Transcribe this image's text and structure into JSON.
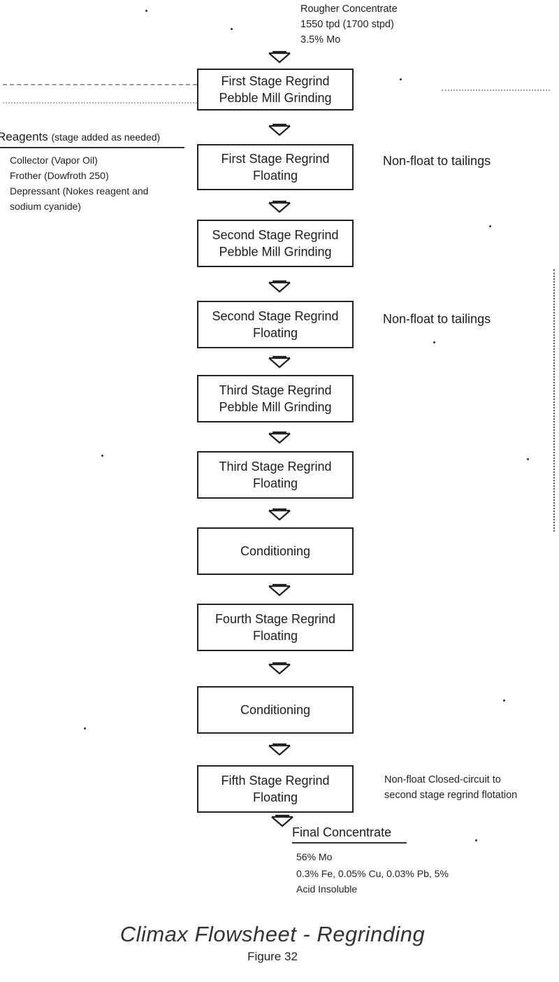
{
  "feed": {
    "title": "Rougher Concentrate",
    "rate": "1550 tpd (1700 stpd)",
    "grade": "3.5% Mo"
  },
  "reagents": {
    "heading": "Reagents",
    "heading_note": "(stage added as needed)",
    "items": [
      "Collector (Vapor Oil)",
      "Frother (Dowfroth 250)",
      "Depressant (Nokes reagent and",
      "sodium cyanide)"
    ]
  },
  "stages": [
    {
      "line1": "First Stage Regrind",
      "line2": "Pebble Mill Grinding",
      "side_note": ""
    },
    {
      "line1": "First Stage Regrind",
      "line2": "Floating",
      "side_note": "Non-float to tailings"
    },
    {
      "line1": "Second Stage Regrind",
      "line2": "Pebble Mill Grinding",
      "side_note": ""
    },
    {
      "line1": "Second Stage Regrind",
      "line2": "Floating",
      "side_note": "Non-float to tailings"
    },
    {
      "line1": "Third Stage Regrind",
      "line2": "Pebble Mill Grinding",
      "side_note": ""
    },
    {
      "line1": "Third Stage Regrind",
      "line2": "Floating",
      "side_note": ""
    },
    {
      "line1": "Conditioning",
      "line2": "",
      "side_note": ""
    },
    {
      "line1": "Fourth Stage Regrind",
      "line2": "Floating",
      "side_note": ""
    },
    {
      "line1": "Conditioning",
      "line2": "",
      "side_note": ""
    },
    {
      "line1": "Fifth Stage Regrind",
      "line2": "Floating",
      "side_note": ""
    }
  ],
  "fifth_stage_note": {
    "line1": "Non-float Closed-circuit to",
    "line2": "second stage regrind flotation"
  },
  "product": {
    "title": "Final Concentrate",
    "grade": "56% Mo",
    "impurities": "0.3% Fe, 0.05% Cu, 0.03% Pb, 5%",
    "impurities_cont": "Acid Insoluble"
  },
  "caption": {
    "title": "Climax Flowsheet - Regrinding",
    "figure": "Figure 32"
  },
  "icons": {
    "flow_arrow": "down-arrow-icon"
  }
}
